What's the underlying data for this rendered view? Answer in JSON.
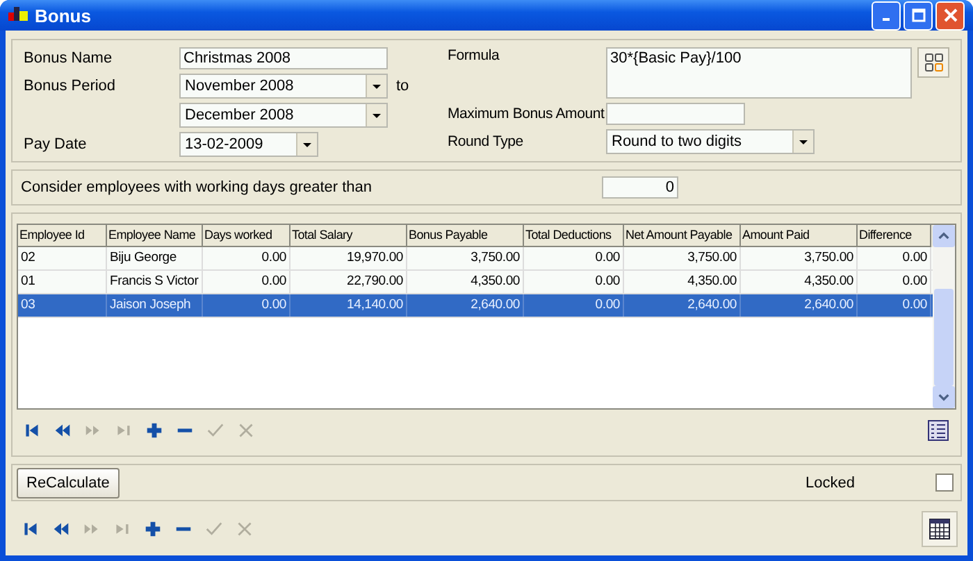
{
  "window": {
    "title": "Bonus"
  },
  "form": {
    "bonus_name_label": "Bonus Name",
    "bonus_name": "Christmas 2008",
    "bonus_period_label": "Bonus Period",
    "period_from": "November 2008",
    "to_label": "to",
    "period_to": "December 2008",
    "pay_date_label": "Pay Date",
    "pay_date": "13-02-2009",
    "formula_label": "Formula",
    "formula": "30*{Basic Pay}/100",
    "max_bonus_label": "Maximum Bonus Amount",
    "round_type_label": "Round Type",
    "round_type": "Round to two digits"
  },
  "working_days": {
    "label": "Consider employees with working days greater than",
    "value": "0"
  },
  "table": {
    "columns": [
      "Employee Id",
      "Employee Name",
      "Days worked",
      "Total Salary",
      "Bonus Payable",
      "Total Deductions",
      "Net Amount Payable",
      "Amount Paid",
      "Difference"
    ],
    "rows": [
      {
        "cells": [
          "02",
          "Biju George",
          "0.00",
          "19,970.00",
          "3,750.00",
          "0.00",
          "3,750.00",
          "3,750.00",
          "0.00"
        ],
        "selected": false
      },
      {
        "cells": [
          "01",
          "Francis S  Victor",
          "0.00",
          "22,790.00",
          "4,350.00",
          "0.00",
          "4,350.00",
          "4,350.00",
          "0.00"
        ],
        "selected": false
      },
      {
        "cells": [
          "03",
          "Jaison Joseph",
          "0.00",
          "14,140.00",
          "2,640.00",
          "0.00",
          "2,640.00",
          "2,640.00",
          "0.00"
        ],
        "selected": true
      }
    ]
  },
  "grid_navigator": [
    {
      "kind": "first",
      "disabled": false
    },
    {
      "kind": "prev",
      "disabled": false
    },
    {
      "kind": "next",
      "disabled": true
    },
    {
      "kind": "last",
      "disabled": true
    },
    {
      "kind": "add",
      "disabled": false
    },
    {
      "kind": "remove",
      "disabled": false
    },
    {
      "kind": "confirm",
      "disabled": true
    },
    {
      "kind": "cancel",
      "disabled": true
    }
  ],
  "recalculate_button": "ReCalculate",
  "locked": {
    "label": "Locked",
    "checked": false
  },
  "form_navigator": [
    {
      "kind": "first",
      "disabled": false
    },
    {
      "kind": "prev",
      "disabled": false
    },
    {
      "kind": "next",
      "disabled": true
    },
    {
      "kind": "last",
      "disabled": true
    },
    {
      "kind": "add",
      "disabled": false
    },
    {
      "kind": "remove",
      "disabled": false
    },
    {
      "kind": "confirm",
      "disabled": true
    },
    {
      "kind": "cancel",
      "disabled": true
    }
  ]
}
